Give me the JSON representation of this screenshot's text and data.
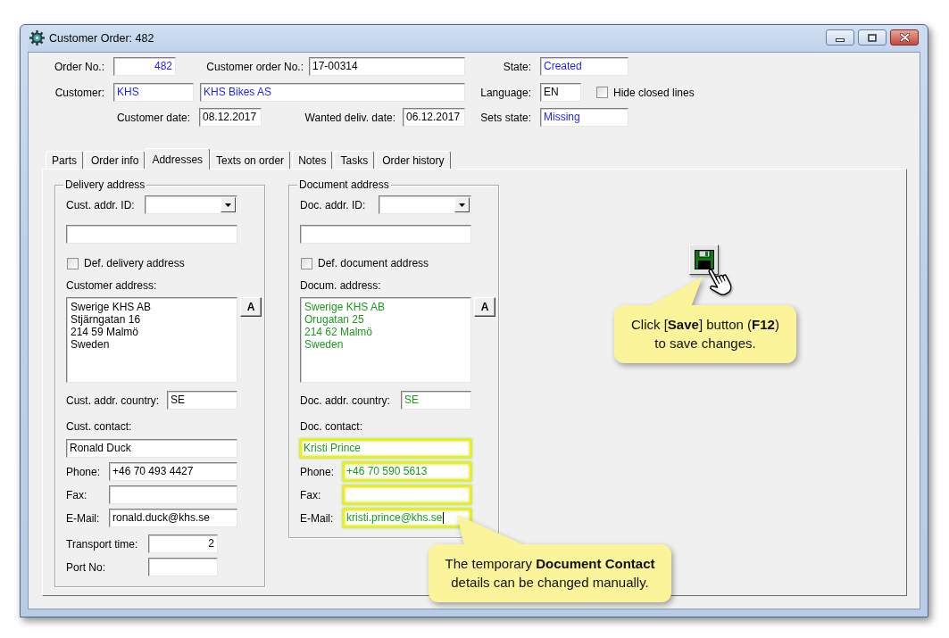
{
  "window": {
    "title": "Customer Order: 482"
  },
  "header": {
    "order_no": {
      "label": "Order No.:",
      "value": "482",
      "color": "#1e1eff"
    },
    "customer_order_no": {
      "label": "Customer order No.:",
      "value": "17-00314",
      "color": "#000000"
    },
    "state": {
      "label": "State:",
      "value": "Created",
      "color": "#1e1eff"
    },
    "customer": {
      "label": "Customer:",
      "code": "KHS",
      "name": "KHS Bikes AS",
      "color": "#1e1eff"
    },
    "language": {
      "label": "Language:",
      "value": "EN",
      "color": "#000000"
    },
    "hide_closed_lines": {
      "label": "Hide closed lines",
      "checked": false
    },
    "customer_date": {
      "label": "Customer date:",
      "value": "08.12.2017",
      "color": "#000000"
    },
    "wanted_delivery_date": {
      "label": "Wanted deliv. date:",
      "value": "06.12.2017",
      "color": "#000000"
    },
    "sets_state": {
      "label": "Sets state:",
      "value": "Missing",
      "color": "#1e1eff"
    }
  },
  "tabs": [
    {
      "label": "Parts",
      "selected": false
    },
    {
      "label": "Order info",
      "selected": false
    },
    {
      "label": "Addresses",
      "selected": true
    },
    {
      "label": "Texts on order",
      "selected": false
    },
    {
      "label": "Notes",
      "selected": false
    },
    {
      "label": "Tasks",
      "selected": false
    },
    {
      "label": "Order history",
      "selected": false
    }
  ],
  "address_groups": [
    {
      "title": "Delivery address",
      "color": "#000000",
      "id_label": "Cust. addr. ID:",
      "default": {
        "label": "Def. delivery address",
        "checked": false
      },
      "address_label": "Customer address:",
      "address": "Swerige KHS AB\nStjärngatan 16\n214 59 Malmö\nSweden",
      "address_button": "A",
      "country": {
        "label": "Cust. addr. country:",
        "value": "SE"
      },
      "contact_label": "Cust. contact:",
      "contact": {
        "value": "Ronald Duck",
        "highlighted": false,
        "focused": false
      },
      "contact_fields": [
        {
          "label": "Phone:",
          "value": "+46 70 493 4427",
          "highlighted": false,
          "focused": false
        },
        {
          "label": "Fax:",
          "highlighted": false,
          "focused": false
        },
        {
          "label": "E-Mail:",
          "value": "ronald.duck@khs.se",
          "highlighted": false,
          "focused": false
        }
      ],
      "extra_fields": [
        {
          "label": "Transport time:",
          "value": "2"
        },
        {
          "label": "Port No:"
        }
      ]
    },
    {
      "title": "Document address",
      "color": "#1a9a1a",
      "id_label": "Doc. addr. ID:",
      "default": {
        "label": "Def. document address",
        "checked": false
      },
      "address_label": "Docum. address:",
      "address": "Swerige KHS AB\nOrugatan 25\n214 62 Malmö\nSweden",
      "address_button": "A",
      "country": {
        "label": "Doc. addr. country:",
        "value": "SE"
      },
      "contact_label": "Doc. contact:",
      "contact": {
        "value": "Kristi Prince",
        "highlighted": true,
        "focused": false
      },
      "contact_fields": [
        {
          "label": "Phone:",
          "value": "+46 70 590 5613",
          "highlighted": true,
          "focused": false
        },
        {
          "label": "Fax:",
          "highlighted": true,
          "focused": false
        },
        {
          "label": "E-Mail:",
          "value": "kristi.prince@khs.se",
          "highlighted": true,
          "focused": true
        }
      ]
    }
  ],
  "callouts": [
    {
      "text": "Click [**Save**] button (**F12**)\nto save changes."
    },
    {
      "text": "The temporary **Document Contact**\ndetails can be changed manually."
    }
  ]
}
